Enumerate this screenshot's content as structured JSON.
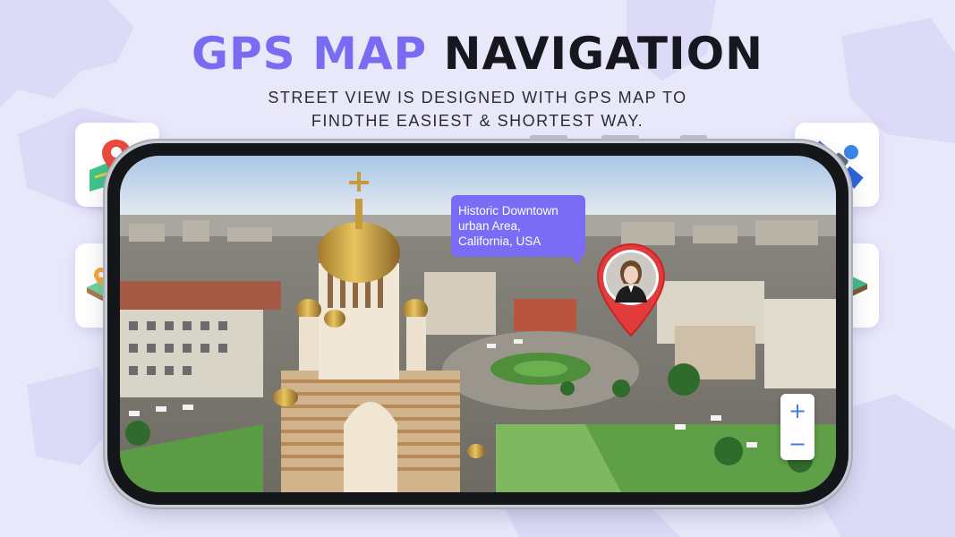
{
  "headline": {
    "accent": "GPS MAP",
    "rest": "NAVIGATION"
  },
  "subtitle": {
    "line1": "STREET VIEW IS DESIGNED WITH GPS MAP TO",
    "line2": "FINDTHE EASIEST & SHORTEST WAY."
  },
  "feature_icons": [
    "map-pin-icon",
    "route-pins-terrain-icon",
    "satellite-icon",
    "3d-terrain-icon"
  ],
  "map": {
    "location_label": "Historic Downtown urban Area, California, USA",
    "zoom_in_label": "+",
    "zoom_out_label": "−"
  },
  "colors": {
    "accent": "#7a6cf2",
    "tooltip": "#7b6cf6",
    "pin": "#e23b3b",
    "zoom": "#3d7be0"
  }
}
